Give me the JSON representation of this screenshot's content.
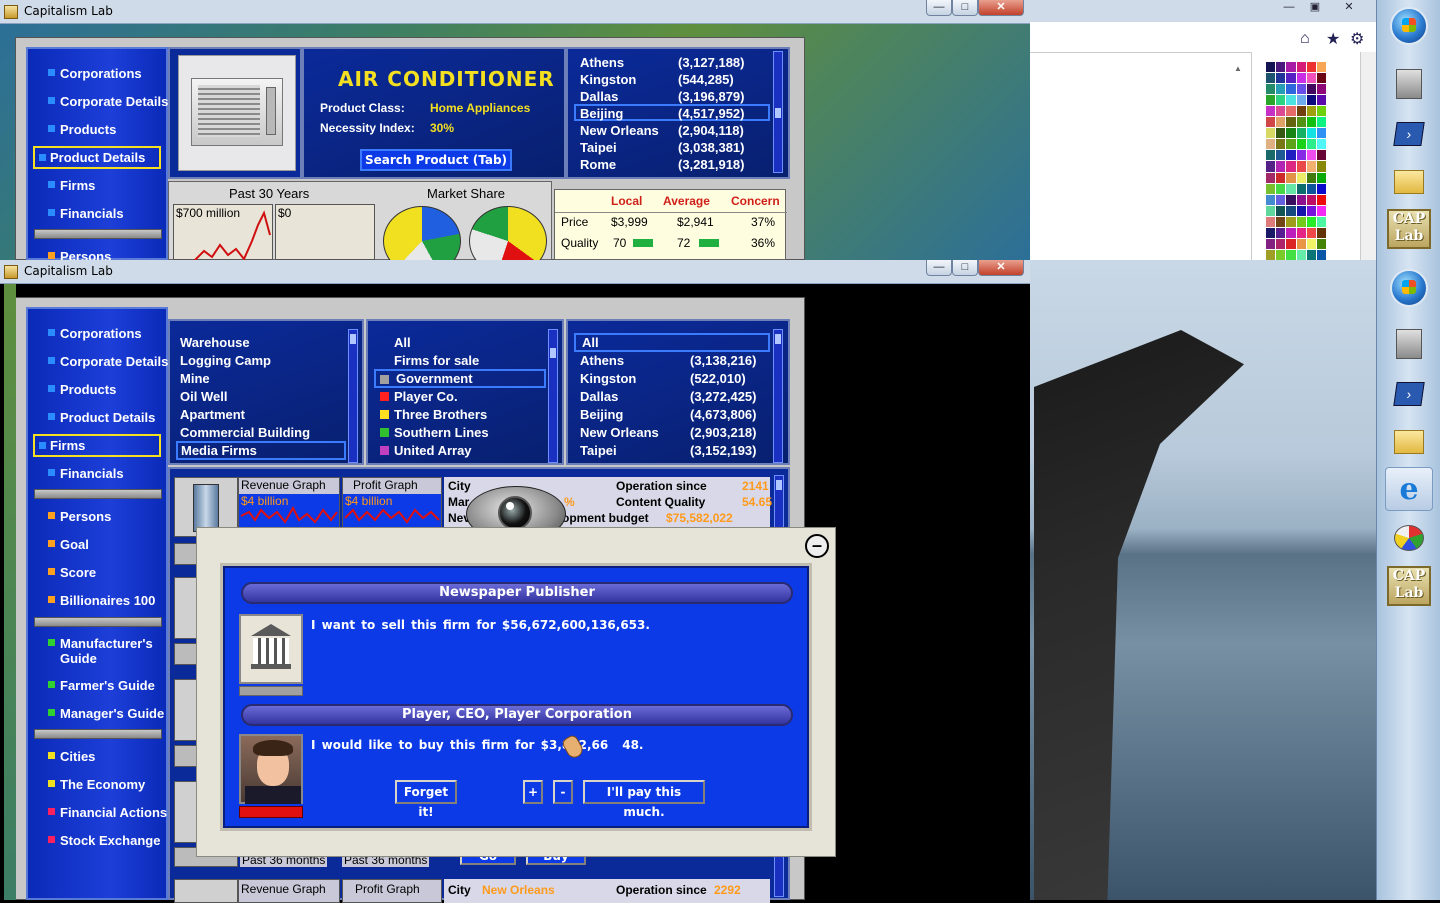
{
  "window1": {
    "title": "Capitalism Lab"
  },
  "window2": {
    "title": "Capitalism Lab"
  },
  "window_buttons": {
    "minimize": "—",
    "maximize": "□",
    "close": "✕"
  },
  "right_window_buttons": {
    "minimize": "—",
    "restore": "▣",
    "close": "✕"
  },
  "sidebar_top": {
    "items": [
      {
        "label": "Corporations",
        "color": "#2a8cff"
      },
      {
        "label": "Corporate Details",
        "color": "#2a8cff"
      },
      {
        "label": "Products",
        "color": "#2a8cff"
      },
      {
        "label": "Product Details",
        "color": "#2a8cff",
        "selected": true
      },
      {
        "label": "Firms",
        "color": "#2a8cff"
      },
      {
        "label": "Financials",
        "color": "#2a8cff"
      },
      {
        "label": "Persons",
        "color": "#ffa020"
      }
    ]
  },
  "product": {
    "name": "AIR CONDITIONER",
    "class_label": "Product Class:",
    "class_value": "Home Appliances",
    "necessity_label": "Necessity Index:",
    "necessity_value": "30%",
    "search_button": "Search Product (Tab)"
  },
  "cities_top": [
    {
      "name": "Athens",
      "value": "(3,127,188)"
    },
    {
      "name": "Kingston",
      "value": "(544,285)"
    },
    {
      "name": "Dallas",
      "value": "(3,196,879)"
    },
    {
      "name": "Beijing",
      "value": "(4,517,952)",
      "selected": true
    },
    {
      "name": "New Orleans",
      "value": "(2,904,118)"
    },
    {
      "name": "Taipei",
      "value": "(3,038,381)"
    },
    {
      "name": "Rome",
      "value": "(3,281,918)"
    }
  ],
  "history": {
    "title": "Past 30 Years",
    "box1": "$700 million",
    "box2": "$0"
  },
  "market_share": {
    "title": "Market Share"
  },
  "price_table": {
    "headers": [
      "Local",
      "Average",
      "Concern"
    ],
    "rows": [
      {
        "label": "Price",
        "local": "$3,999",
        "average": "$2,941",
        "concern": "37%"
      },
      {
        "label": "Quality",
        "local": "70",
        "average": "72",
        "concern": "36%"
      }
    ]
  },
  "sidebar_bottom": {
    "groups": [
      [
        {
          "label": "Corporations",
          "color": "#2a8cff"
        },
        {
          "label": "Corporate Details",
          "color": "#2a8cff"
        },
        {
          "label": "Products",
          "color": "#2a8cff"
        },
        {
          "label": "Product Details",
          "color": "#2a8cff"
        },
        {
          "label": "Firms",
          "color": "#2a8cff",
          "selected": true
        },
        {
          "label": "Financials",
          "color": "#2a8cff"
        }
      ],
      [
        {
          "label": "Persons",
          "color": "#ffa020"
        },
        {
          "label": "Goal",
          "color": "#ffa020"
        },
        {
          "label": "Score",
          "color": "#ffa020"
        },
        {
          "label": "Billionaires 100",
          "color": "#ffa020"
        }
      ],
      [
        {
          "label": "Manufacturer's Guide",
          "color": "#30d030"
        },
        {
          "label": "Farmer's Guide",
          "color": "#30d030"
        },
        {
          "label": "Manager's Guide",
          "color": "#30d030"
        }
      ],
      [
        {
          "label": "Cities",
          "color": "#f0e020"
        },
        {
          "label": "The Economy",
          "color": "#f0e020"
        },
        {
          "label": "Financial Actions",
          "color": "#ff2060"
        },
        {
          "label": "Stock Exchange",
          "color": "#ff2060"
        }
      ]
    ]
  },
  "firm_types": [
    "Warehouse",
    "Logging Camp",
    "Mine",
    "Oil Well",
    "Apartment",
    "Commercial Building",
    "Media Firms"
  ],
  "owners": [
    {
      "label": "All",
      "color": ""
    },
    {
      "label": "Firms for sale",
      "color": ""
    },
    {
      "label": "Government",
      "color": "#a0a0a0",
      "selected": true
    },
    {
      "label": "Player Co.",
      "color": "#ff2020"
    },
    {
      "label": "Three Brothers",
      "color": "#ffe020"
    },
    {
      "label": "Southern Lines",
      "color": "#30c030"
    },
    {
      "label": "United Array",
      "color": "#c040c0"
    }
  ],
  "cities_bottom": [
    {
      "name": "All",
      "value": "",
      "selected": true
    },
    {
      "name": "Athens",
      "value": "(3,138,216)"
    },
    {
      "name": "Kingston",
      "value": "(522,010)"
    },
    {
      "name": "Dallas",
      "value": "(3,272,425)"
    },
    {
      "name": "Beijing",
      "value": "(4,673,806)"
    },
    {
      "name": "New Orleans",
      "value": "(2,903,218)"
    },
    {
      "name": "Taipei",
      "value": "(3,152,193)"
    }
  ],
  "firm_row1": {
    "rev_label": "Revenue Graph",
    "rev_value": "$4 billion",
    "profit_label": "Profit Graph",
    "profit_value": "$4 billion",
    "city_label": "City",
    "mar": "Mar",
    "nev": "Nev",
    "op_since_label": "Operation since",
    "op_since_value": "2141",
    "quality_label": "Content Quality",
    "quality_value": "54.65",
    "budget_label": "opment budget",
    "budget_value": "$75,582,022",
    "pct": "%"
  },
  "firm_row_last": {
    "rev_label": "Revenue Graph",
    "profit_label": "Profit Graph",
    "city_label": "City",
    "city_value": "New Orleans",
    "op_since_label": "Operation since",
    "op_since_value": "2292",
    "past1": "Past 36 months",
    "past2": "Past 36 months",
    "go": "Go",
    "buy": "Buy"
  },
  "dialog": {
    "seller_title": "Newspaper Publisher",
    "seller_msg": "I want to sell this firm for $56,672,600,136,653.",
    "buyer_title": "Player, CEO, Player Corporation",
    "buyer_msg": "I would like to buy this firm for $3,822,66",
    "buyer_msg_tail": "48.",
    "forget": "Forget it!",
    "plus": "+",
    "minus": "-",
    "pay": "I'll pay this much.",
    "close_icon": "⊖"
  },
  "taskbar_icons": [
    "start-orb-icon",
    "wizard-icon",
    "powershell-icon",
    "folder-icon",
    "caplab-icon"
  ],
  "taskbar_icons2": [
    "start-orb-icon",
    "wizard-icon",
    "powershell-icon",
    "folder-icon",
    "ie-icon",
    "paint-icon",
    "caplab-icon"
  ],
  "cap_logo": "CAP Lab"
}
